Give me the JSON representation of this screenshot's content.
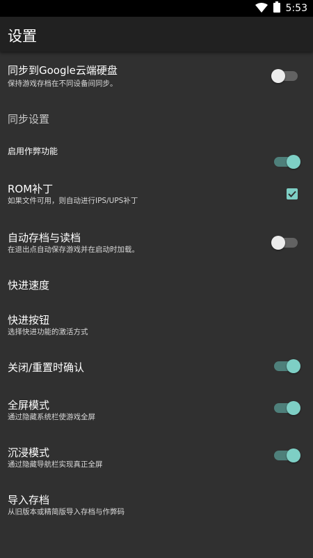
{
  "status": {
    "time": "5:53",
    "icons": [
      "wifi-icon",
      "battery-icon"
    ]
  },
  "app_bar": {
    "title": "设置"
  },
  "colors": {
    "accent": "#7ecfc5",
    "background": "#303030",
    "app_bar": "#212121"
  },
  "settings": {
    "sync_drive": {
      "title": "同步到Google云端硬盘",
      "subtitle": "保持游戏存档在不同设备间同步。",
      "enabled": false
    },
    "sync_settings": {
      "title": "同步设置"
    },
    "cheats": {
      "title": "启用作弊功能",
      "enabled": true
    },
    "rom_patch": {
      "title": "ROM补丁",
      "subtitle": "如果文件可用，则自动进行IPS/UPS补丁",
      "checked": true
    },
    "auto_save": {
      "title": "自动存档与读档",
      "subtitle": "在退出点自动保存游戏并在启动时加载。",
      "enabled": false
    },
    "ff_speed": {
      "title": "快进速度"
    },
    "ff_button": {
      "title": "快进按钮",
      "subtitle": "选择快进功能的激活方式"
    },
    "confirm_close": {
      "title": "关闭/重置时确认",
      "enabled": true
    },
    "fullscreen": {
      "title": "全屏模式",
      "subtitle": "通过隐藏系统栏使游戏全屏",
      "enabled": true
    },
    "immersive": {
      "title": "沉浸模式",
      "subtitle": "通过隐藏导航栏实现真正全屏",
      "enabled": true
    },
    "import_saves": {
      "title": "导入存档",
      "subtitle": "从旧版本或精简版导入存档与作弊码"
    }
  }
}
